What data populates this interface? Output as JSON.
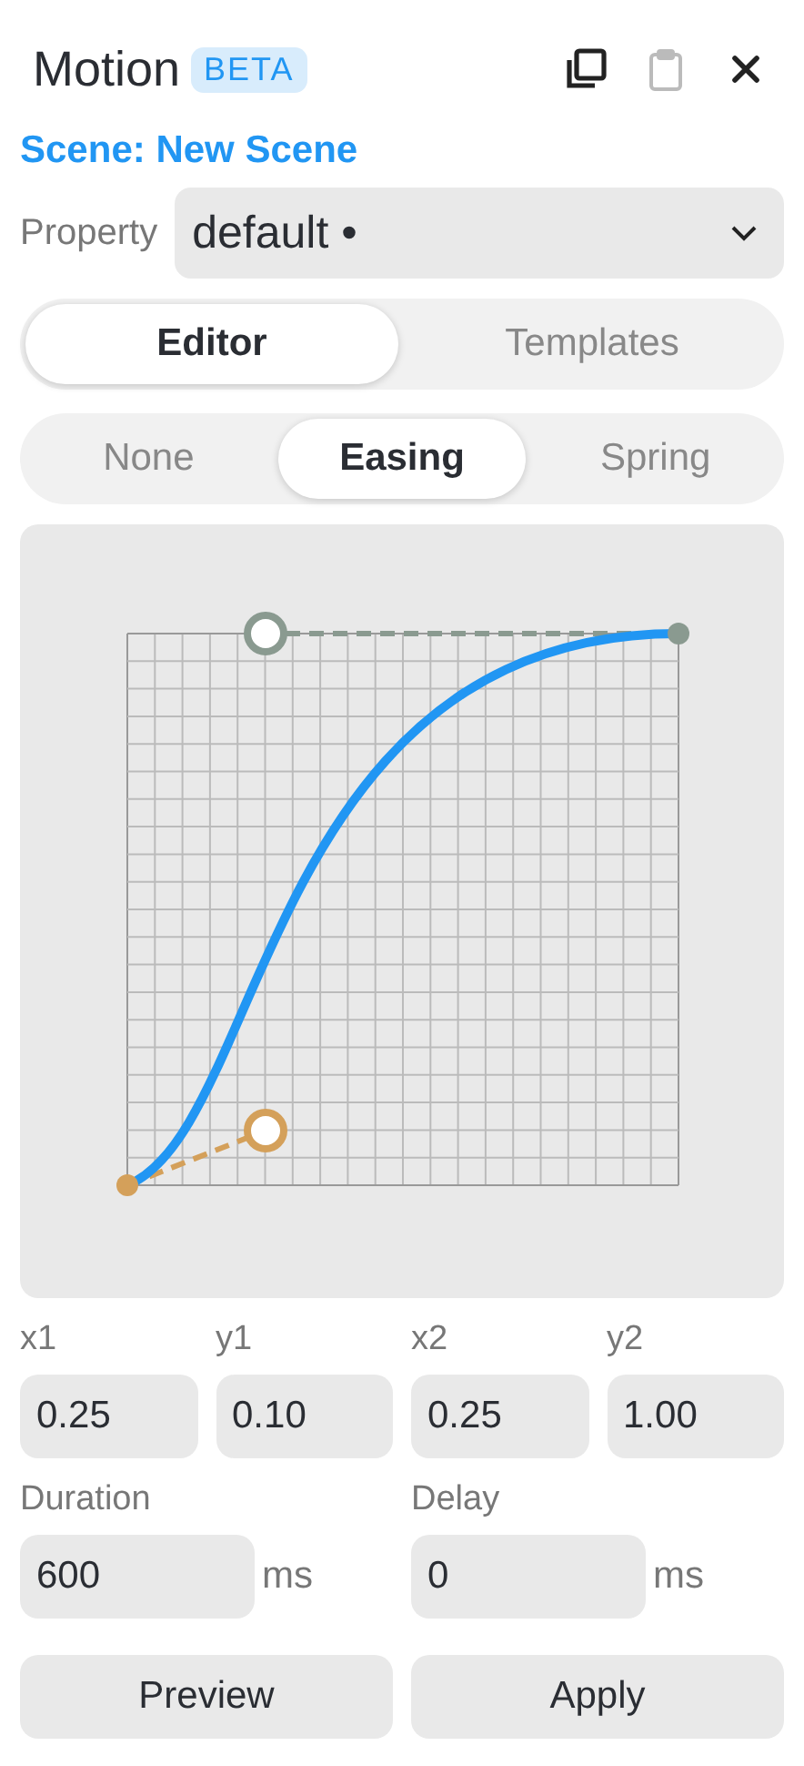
{
  "header": {
    "title": "Motion",
    "badge": "BETA",
    "actions": [
      {
        "kind": "copy",
        "disabled": false
      },
      {
        "kind": "paste",
        "disabled": true
      },
      {
        "kind": "close",
        "disabled": false
      }
    ]
  },
  "scene": "Scene: New Scene",
  "property": {
    "label": "Property",
    "value": "default •"
  },
  "mode_tabs": [
    {
      "label": "Editor",
      "selected": true
    },
    {
      "label": "Templates",
      "selected": false
    }
  ],
  "curve_tabs": [
    {
      "label": "None",
      "selected": false
    },
    {
      "label": "Easing",
      "selected": true
    },
    {
      "label": "Spring",
      "selected": false
    }
  ],
  "params": [
    {
      "label": "x1",
      "value": "0.25"
    },
    {
      "label": "y1",
      "value": "0.10"
    },
    {
      "label": "x2",
      "value": "0.25"
    },
    {
      "label": "y2",
      "value": "1.00"
    }
  ],
  "timing": [
    {
      "label": "Duration",
      "value": "600",
      "unit": "ms"
    },
    {
      "label": "Delay",
      "value": "0",
      "unit": "ms"
    }
  ],
  "buttons": [
    "Preview",
    "Apply"
  ]
}
